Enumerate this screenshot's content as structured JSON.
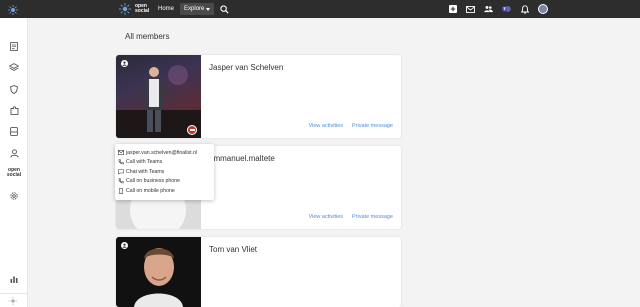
{
  "brand": {
    "line1": "open",
    "line2": "social"
  },
  "nav": {
    "home": "Home",
    "explore": "Explore"
  },
  "page": {
    "title": "All members"
  },
  "members": [
    {
      "name": "Jasper van Schelven",
      "view_activities": "View activities",
      "private_message": "Private message"
    },
    {
      "name": "emmanuel.maltete",
      "view_activities": "View activities",
      "private_message": "Private message"
    },
    {
      "name": "Tom van Vliet"
    }
  ],
  "contact_popup": {
    "email": "jasper.van.schelven@finalist.nl",
    "call_teams": "Call with Teams",
    "chat_teams": "Chat with Teams",
    "call_business": "Call on business phone",
    "call_mobile": "Call on mobile phone"
  },
  "sidebar": {
    "logo_line1": "open",
    "logo_line2": "social"
  },
  "icons": [
    "open-social-logo-icon",
    "search-icon",
    "plus-icon",
    "mail-icon",
    "people-icon",
    "teams-icon",
    "bell-icon",
    "user-avatar-icon",
    "document-icon",
    "layers-icon",
    "shield-icon",
    "puzzle-icon",
    "inbox-icon",
    "user-icon",
    "gear-icon",
    "bar-chart-icon",
    "email-icon",
    "phone-icon",
    "chat-icon",
    "mobile-icon"
  ],
  "colors": {
    "topbar": "#2d2d2d",
    "link": "#4b8fd6",
    "status_red": "#c0392b",
    "background": "#f3f3f3"
  }
}
